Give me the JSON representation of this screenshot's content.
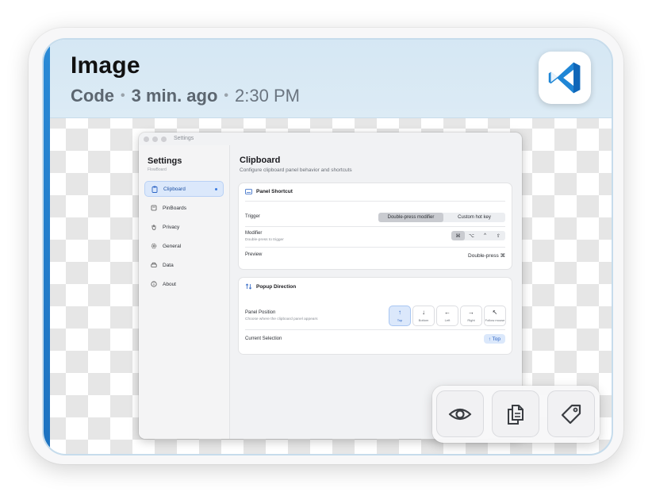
{
  "card": {
    "title": "Image",
    "app_name": "Code",
    "separator": "•",
    "relative_time": "3 min. ago",
    "clock_time": "2:30 PM",
    "app_icon": "vscode-icon",
    "accent_color": "#2a8ad6"
  },
  "settings_window": {
    "window_title": "Settings",
    "sidebar": {
      "title": "Settings",
      "subtitle": "FlowBoard",
      "items": [
        {
          "label": "Clipboard",
          "icon": "clipboard-icon",
          "active": true
        },
        {
          "label": "PinBoards",
          "icon": "pin-icon",
          "active": false
        },
        {
          "label": "Privacy",
          "icon": "hand-icon",
          "active": false
        },
        {
          "label": "General",
          "icon": "gear-icon",
          "active": false
        },
        {
          "label": "Data",
          "icon": "drive-icon",
          "active": false
        },
        {
          "label": "About",
          "icon": "info-icon",
          "active": false
        }
      ]
    },
    "main": {
      "title": "Clipboard",
      "subtitle": "Configure clipboard panel behavior and shortcuts",
      "panel_shortcut": {
        "heading": "Panel Shortcut",
        "trigger_label": "Trigger",
        "trigger_options": [
          "Double-press modifier",
          "Custom hot key"
        ],
        "trigger_selected": "Double-press modifier",
        "modifier_label": "Modifier",
        "modifier_sub": "Double-press to trigger",
        "modifier_keys": [
          "⌘",
          "⌥",
          "^",
          "⇧"
        ],
        "modifier_selected": "⌘",
        "preview_label": "Preview",
        "preview_value": "Double-press ⌘"
      },
      "popup_direction": {
        "heading": "Popup Direction",
        "position_label": "Panel Position",
        "position_sub": "Choose where the clipboard panel appears",
        "options": [
          {
            "arrow": "↑",
            "label": "Top"
          },
          {
            "arrow": "↓",
            "label": "Bottom"
          },
          {
            "arrow": "←",
            "label": "Left"
          },
          {
            "arrow": "→",
            "label": "Right"
          },
          {
            "arrow": "↖",
            "label": "Follow mouse"
          }
        ],
        "selected": "Top",
        "current_label": "Current Selection",
        "current_value": "↑ Top"
      }
    }
  },
  "toolbar": {
    "buttons": [
      {
        "icon": "eye-icon",
        "action": "preview"
      },
      {
        "icon": "copy-icon",
        "action": "copy"
      },
      {
        "icon": "tag-icon",
        "action": "tag"
      }
    ]
  }
}
